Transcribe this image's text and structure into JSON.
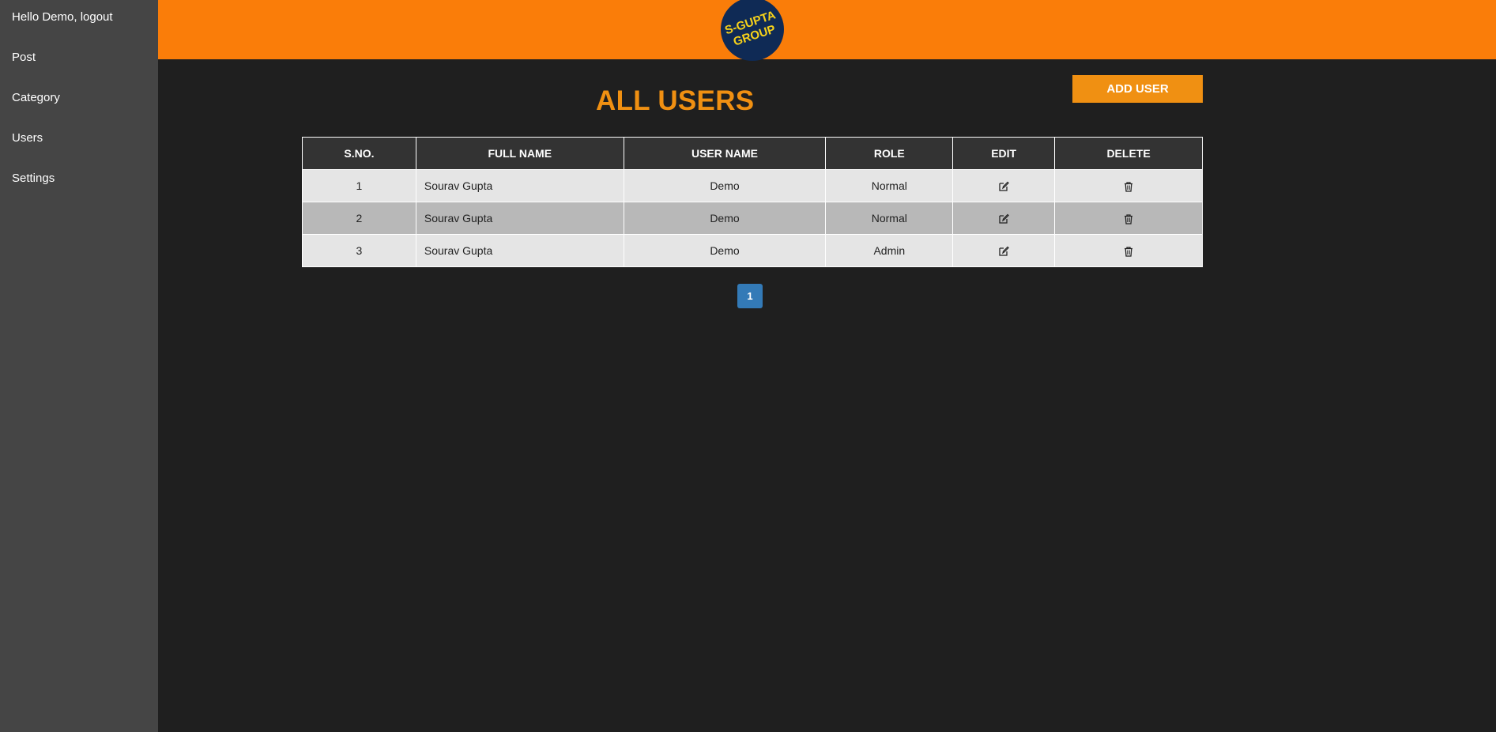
{
  "sidebar": {
    "items": [
      {
        "label": "Hello Demo, logout"
      },
      {
        "label": "Post"
      },
      {
        "label": "Category"
      },
      {
        "label": "Users"
      },
      {
        "label": "Settings"
      }
    ]
  },
  "header": {
    "logo_line1": "S-GUPTA",
    "logo_line2": "GROUP"
  },
  "main": {
    "title": "ALL USERS",
    "add_button": "ADD USER",
    "table": {
      "columns": [
        "S.NO.",
        "FULL NAME",
        "USER NAME",
        "ROLE",
        "EDIT",
        "DELETE"
      ],
      "rows": [
        {
          "sno": "1",
          "full_name": "Sourav Gupta",
          "user_name": "Demo",
          "role": "Normal"
        },
        {
          "sno": "2",
          "full_name": "Sourav Gupta",
          "user_name": "Demo",
          "role": "Normal"
        },
        {
          "sno": "3",
          "full_name": "Sourav Gupta",
          "user_name": "Demo",
          "role": "Admin"
        }
      ],
      "edit_icon": "edit-icon",
      "delete_icon": "trash-icon"
    },
    "pagination": {
      "current_page": "1"
    }
  },
  "colors": {
    "header": "#fa7d09",
    "accent": "#f09012",
    "sidebar": "#454545",
    "background": "#1f1f1f",
    "pagination": "#337ab7",
    "logo_circle": "#0f2a55",
    "logo_text": "#f7d21a"
  }
}
